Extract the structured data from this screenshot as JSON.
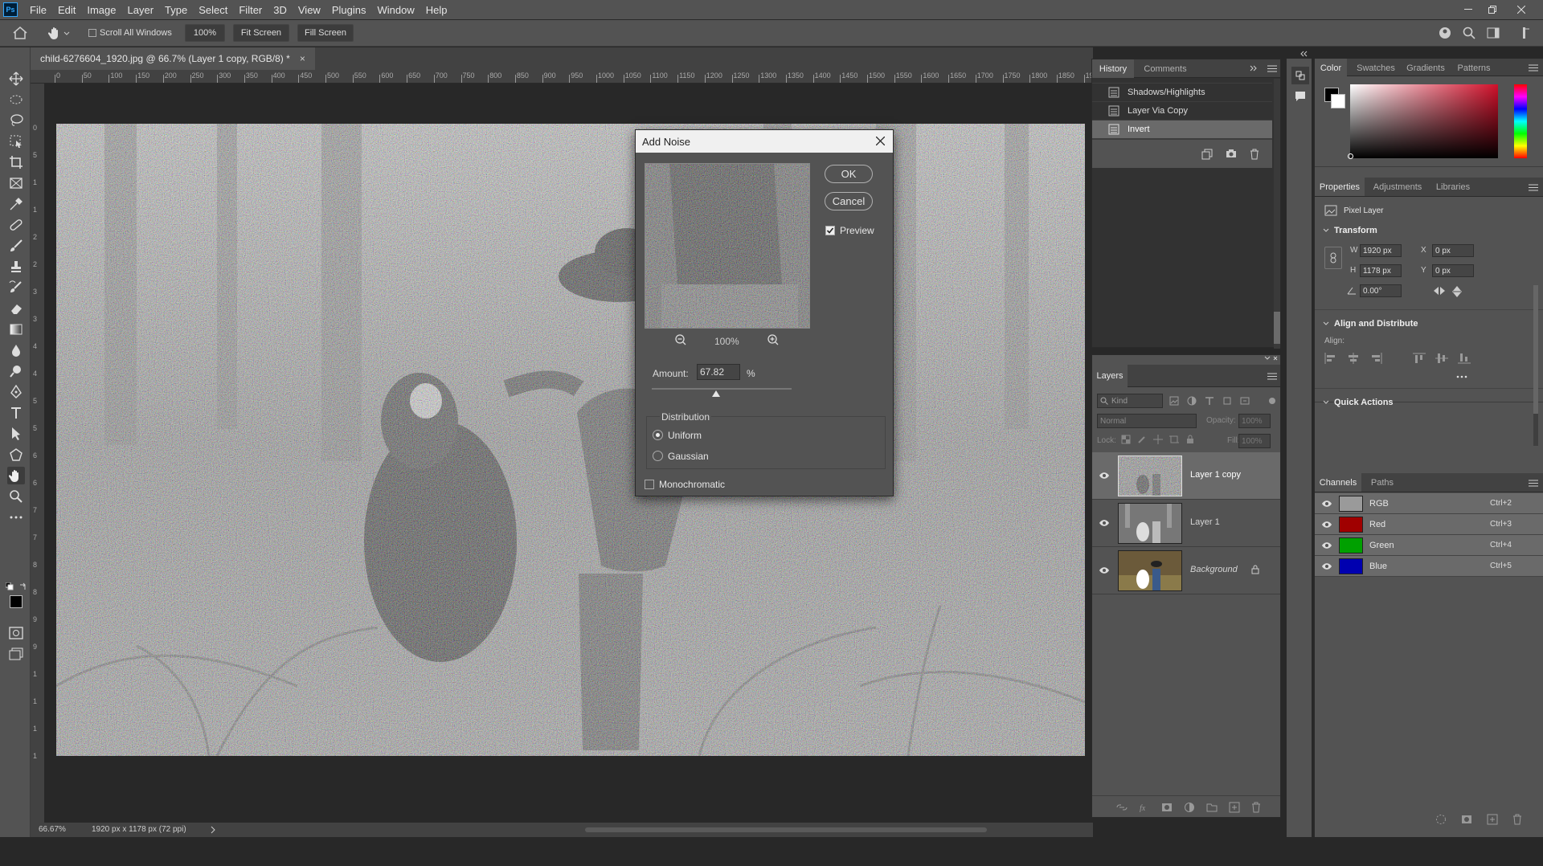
{
  "menu": [
    "File",
    "Edit",
    "Image",
    "Layer",
    "Type",
    "Select",
    "Filter",
    "3D",
    "View",
    "Plugins",
    "Window",
    "Help"
  ],
  "app_logo": "Ps",
  "options": {
    "scroll_all": "Scroll All Windows",
    "zoom": "100%",
    "fit_screen": "Fit Screen",
    "fill_screen": "Fill Screen"
  },
  "document": {
    "tab_title": "child-6276604_1920.jpg @ 66.7% (Layer 1 copy, RGB/8) *",
    "close": "×"
  },
  "ruler_h": [
    "0",
    "50",
    "100",
    "150",
    "200",
    "250",
    "300",
    "350",
    "400",
    "450",
    "500",
    "550",
    "600",
    "650",
    "700",
    "750",
    "800",
    "850",
    "900",
    "950",
    "1000",
    "1050",
    "1100",
    "1150",
    "1200",
    "1250",
    "1300",
    "1350",
    "1400",
    "1450",
    "1500",
    "1550",
    "1600",
    "1650",
    "1700",
    "1750",
    "1800",
    "1850",
    "1900"
  ],
  "ruler_v": [
    "0",
    "5",
    "1",
    "1",
    "2",
    "2",
    "3",
    "3",
    "4",
    "4",
    "5",
    "5",
    "6",
    "6",
    "7",
    "7",
    "8",
    "8",
    "9",
    "9",
    "1",
    "1",
    "1",
    "1"
  ],
  "status": {
    "zoom": "66.67%",
    "dimensions": "1920 px x 1178 px (72 ppi)"
  },
  "dialog": {
    "title": "Add Noise",
    "ok": "OK",
    "cancel": "Cancel",
    "preview_label": "Preview",
    "preview_checked": true,
    "zoom": "100%",
    "amount_label": "Amount:",
    "amount_value": "67.82",
    "amount_unit": "%",
    "amount_slider_pct": 0.46,
    "distribution_label": "Distribution",
    "uniform": "Uniform",
    "gaussian": "Gaussian",
    "selected": "Uniform",
    "monochromatic": "Monochromatic"
  },
  "history": {
    "tabs": [
      "History",
      "Comments"
    ],
    "items": [
      "Shadows/Highlights",
      "Layer Via Copy",
      "Invert"
    ],
    "selected": "Invert"
  },
  "layers": {
    "title": "Layers",
    "kind_placeholder": "Kind",
    "blend_mode": "Normal",
    "opacity_label": "Opacity:",
    "opacity": "100%",
    "lock_label": "Lock:",
    "fill_label": "Fill:",
    "fill": "100%",
    "items": [
      {
        "name": "Layer 1 copy",
        "selected": true
      },
      {
        "name": "Layer 1",
        "selected": false
      },
      {
        "name": "Background",
        "selected": false,
        "locked": true
      }
    ]
  },
  "color_panel": {
    "tabs": [
      "Color",
      "Swatches",
      "Gradients",
      "Patterns"
    ],
    "fg": "#000000",
    "bg": "#ffffff",
    "hue": "#cc1020"
  },
  "properties": {
    "tabs": [
      "Properties",
      "Adjustments",
      "Libraries"
    ],
    "kind": "Pixel Layer",
    "transform_title": "Transform",
    "w_label": "W",
    "w": "1920 px",
    "h_label": "H",
    "h": "1178 px",
    "x_label": "X",
    "x": "0 px",
    "y_label": "Y",
    "y": "0 px",
    "angle": "0.00°",
    "align_title": "Align and Distribute",
    "align_label": "Align:",
    "quick_actions": "Quick Actions"
  },
  "channels": {
    "tabs": [
      "Channels",
      "Paths"
    ],
    "items": [
      {
        "name": "RGB",
        "shortcut": "Ctrl+2",
        "color": "#9a9a9a"
      },
      {
        "name": "Red",
        "shortcut": "Ctrl+3",
        "color": "#a00000"
      },
      {
        "name": "Green",
        "shortcut": "Ctrl+4",
        "color": "#00a000"
      },
      {
        "name": "Blue",
        "shortcut": "Ctrl+5",
        "color": "#0000b0"
      }
    ]
  }
}
